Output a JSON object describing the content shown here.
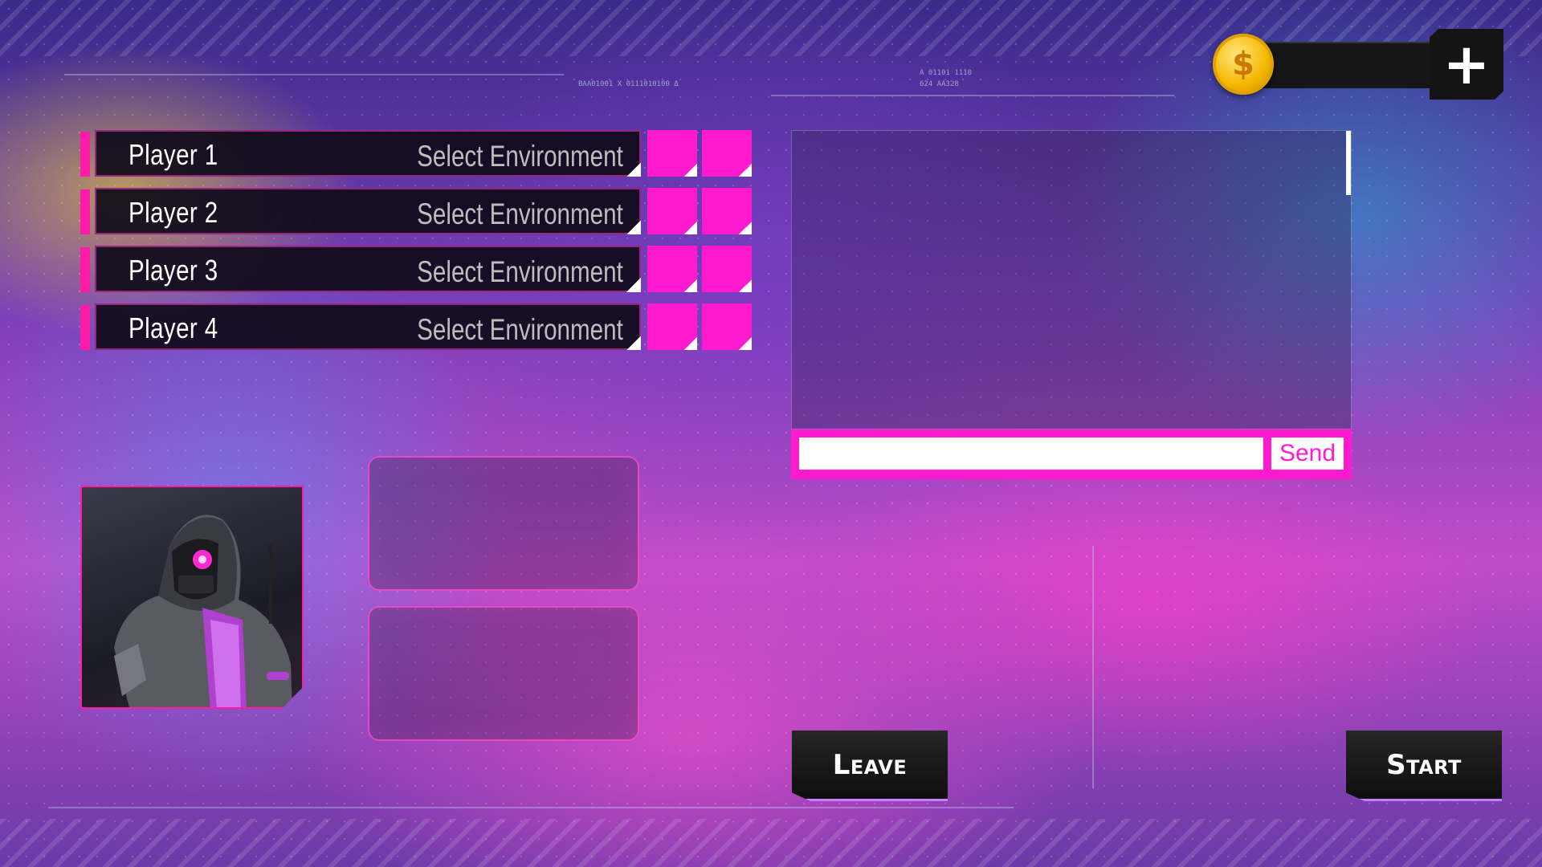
{
  "currency": {
    "symbol": "$",
    "amount": "",
    "add_label": "+"
  },
  "players": [
    {
      "name": "Player 1",
      "environment": "Select Environment"
    },
    {
      "name": "Player 2",
      "environment": "Select Environment"
    },
    {
      "name": "Player 3",
      "environment": "Select Environment"
    },
    {
      "name": "Player 4",
      "environment": "Select Environment"
    }
  ],
  "chat": {
    "input_value": "",
    "send_label": "Send"
  },
  "buttons": {
    "leave": "Leave",
    "start": "Start"
  },
  "hud": {
    "code_1": "BAA01001 X 0111010100 Δ",
    "code_2": "A 01101 1110",
    "code_3": "624 AA328"
  },
  "colors": {
    "accent_magenta": "#ff1ad0",
    "coin_gold": "#f5b800",
    "panel_dark": "#141414"
  }
}
